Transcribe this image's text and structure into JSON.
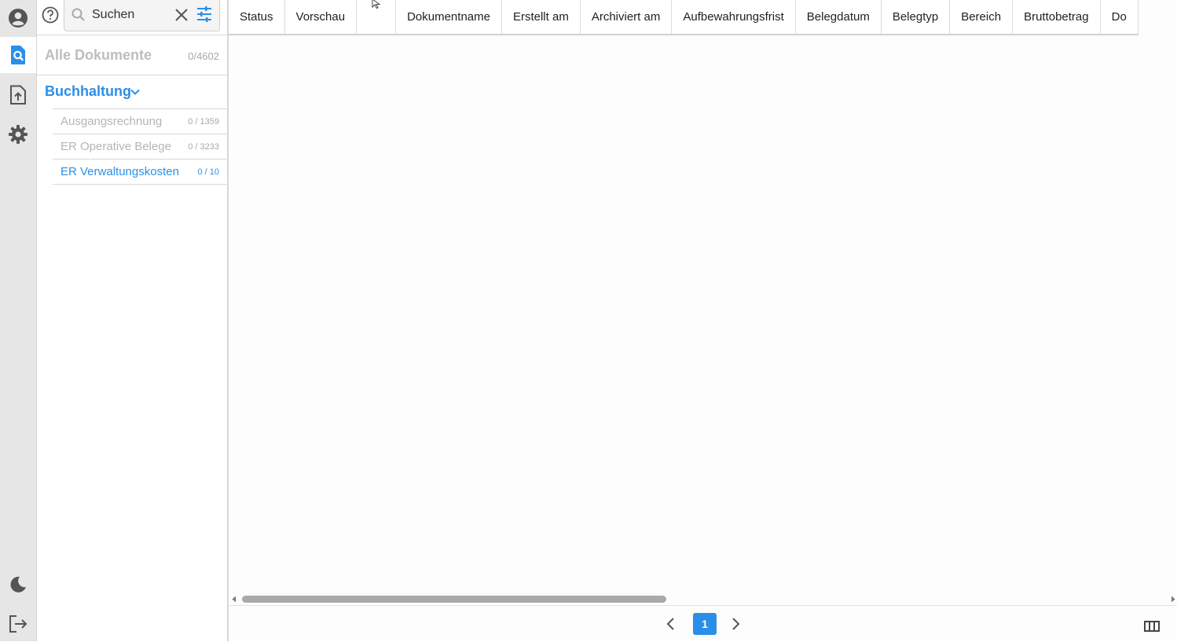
{
  "rail": {
    "top_icons": [
      "user-circle-icon",
      "document-search-icon",
      "document-upload-icon",
      "gear-icon"
    ],
    "bottom_icons": [
      "moon-icon",
      "logout-icon"
    ]
  },
  "search": {
    "placeholder": "Suchen"
  },
  "sidebar": {
    "all_documents": {
      "label": "Alle Dokumente",
      "count": "0/4602"
    },
    "group": {
      "label": "Buchhaltung"
    },
    "items": [
      {
        "label": "Ausgangsrechnung",
        "count": "0 / 1359"
      },
      {
        "label": "ER Operative Belege",
        "count": "0 / 3233"
      },
      {
        "label": "ER Verwaltungskosten",
        "count": "0 / 10"
      }
    ]
  },
  "table": {
    "columns": [
      "Status",
      "Vorschau",
      "",
      "Dokumentname",
      "Erstellt am",
      "Archiviert am",
      "Aufbewahrungsfrist",
      "Belegdatum",
      "Belegtyp",
      "Bereich",
      "Bruttobetrag",
      "Do"
    ]
  },
  "pager": {
    "current_page": "1"
  },
  "colors": {
    "accent": "#2b8fe8",
    "muted": "#b5b5b5",
    "rail_bg": "#e6e6e6"
  }
}
